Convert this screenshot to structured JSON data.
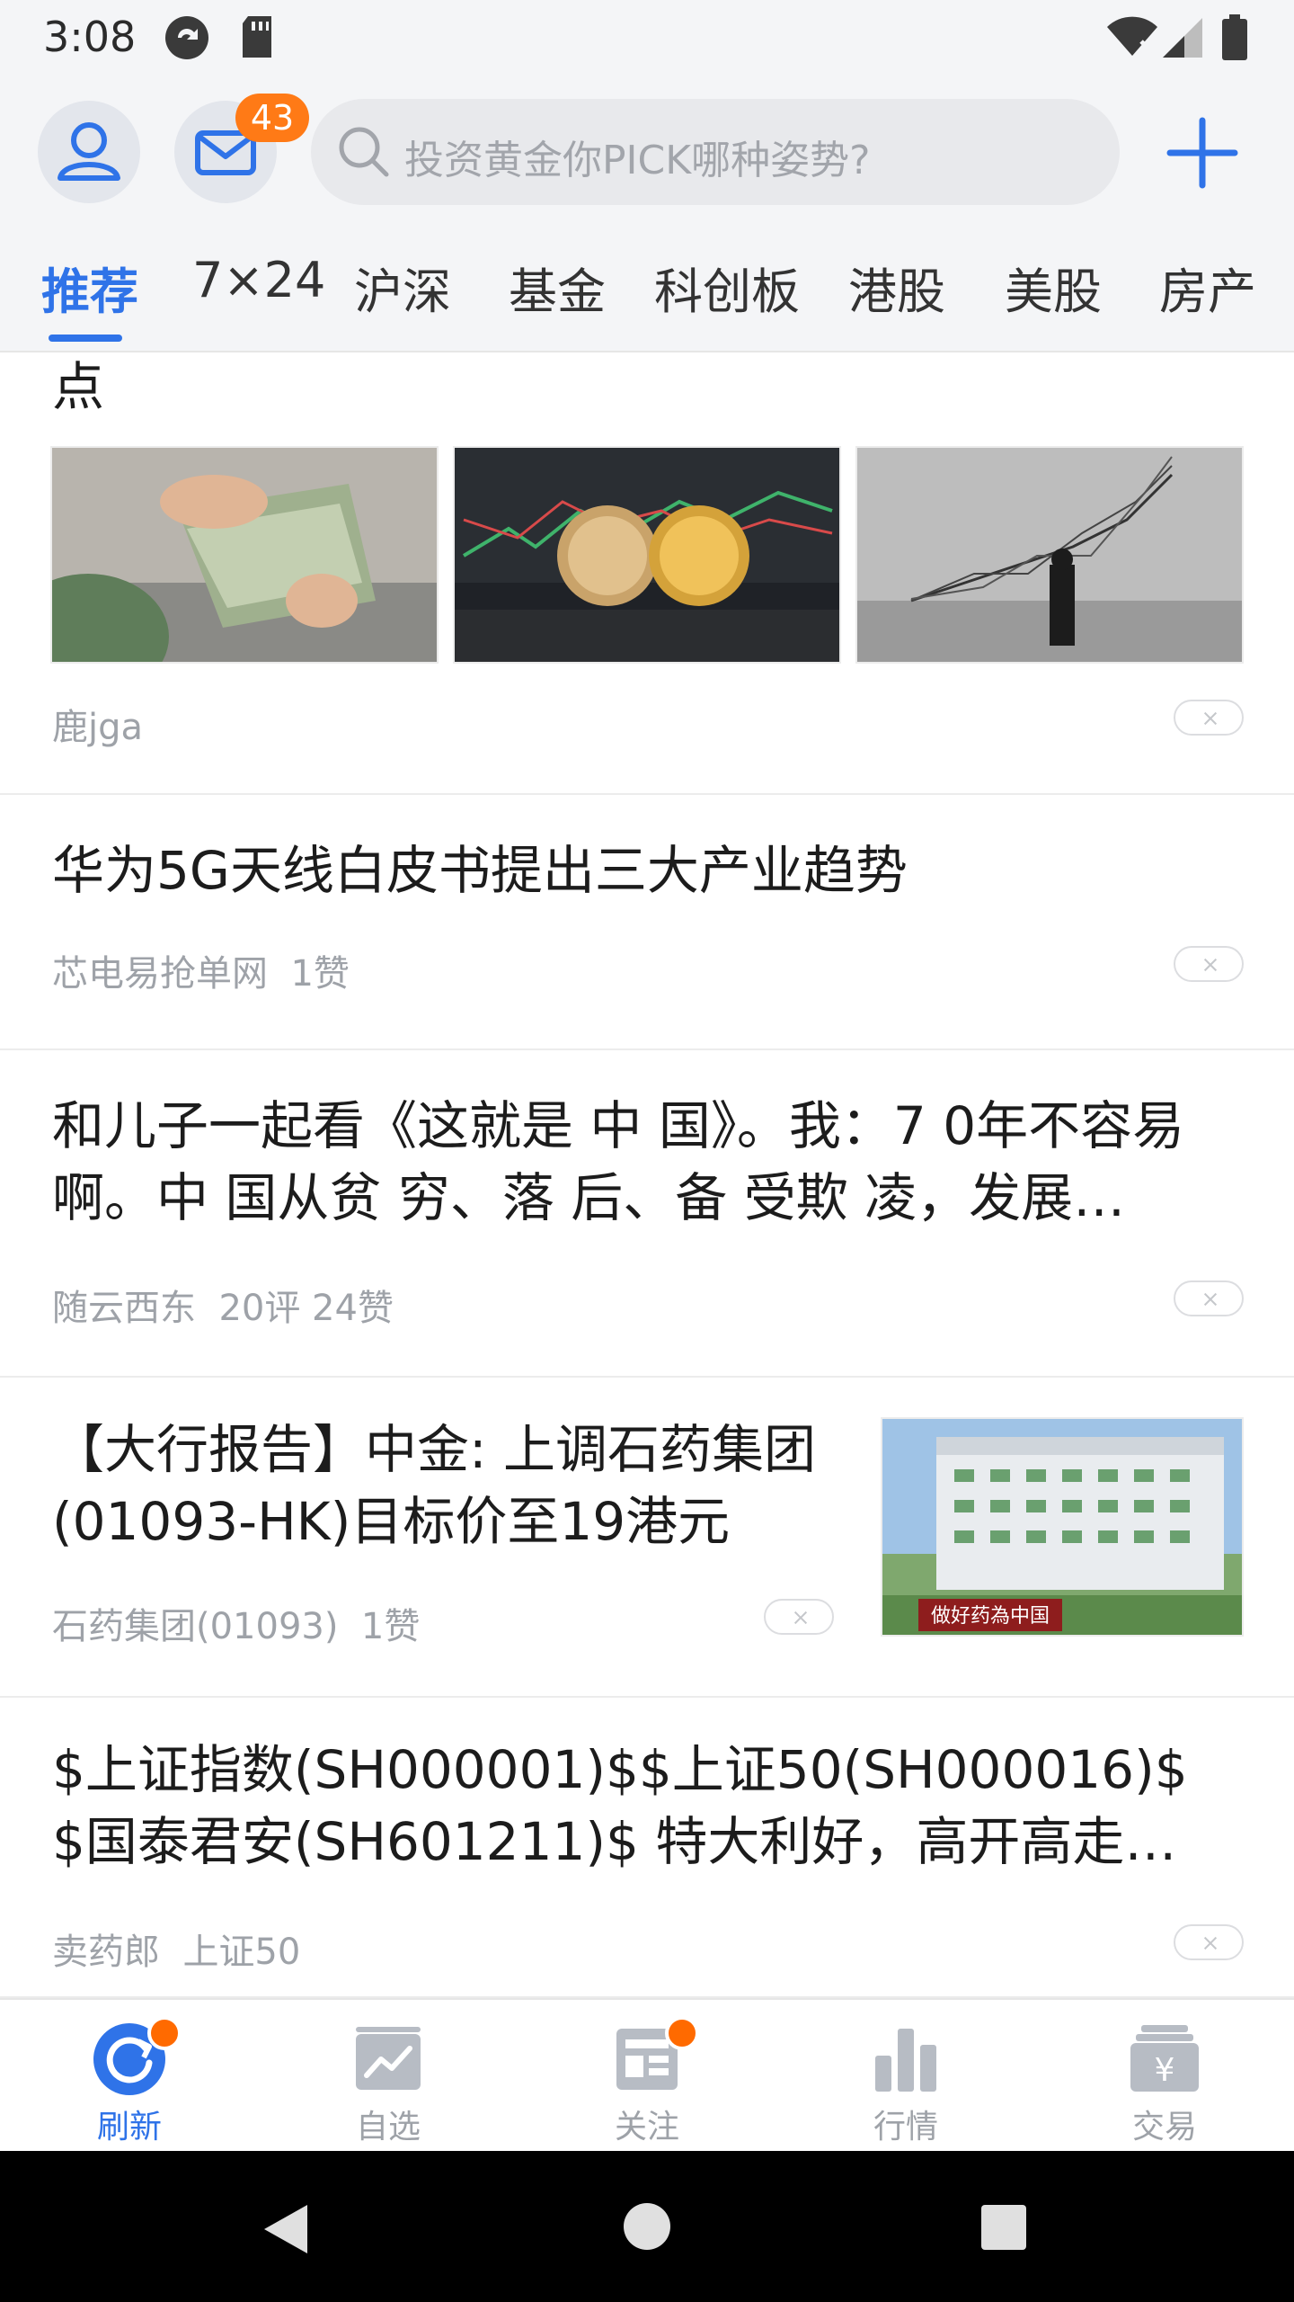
{
  "status_bar": {
    "time": "3:08"
  },
  "header": {
    "mail_badge": "43",
    "search_placeholder": "投资黄金你PICK哪种姿势?"
  },
  "tabs": [
    {
      "label": "推荐",
      "active": true
    },
    {
      "label": "7×24"
    },
    {
      "label": "沪深"
    },
    {
      "label": "基金"
    },
    {
      "label": "科创板"
    },
    {
      "label": "港股"
    },
    {
      "label": "美股"
    },
    {
      "label": "房产"
    }
  ],
  "feed": {
    "item0": {
      "title_tail": "点",
      "author": "鹿jga"
    },
    "item1": {
      "title": "华为5G天线白皮书提出三大产业趋势",
      "author": "芯电易抢单网",
      "stats": "1赞"
    },
    "item2": {
      "title": "和儿子一起看《这就是 中 国》。我：7 0年不容易啊。中 国从贫 穷、落 后、备 受欺 凌，发展…",
      "author": "随云西东",
      "stats": "20评  24赞"
    },
    "item3": {
      "title": "【大行报告】中金: 上调石药集团(01093-HK)目标价至19港元",
      "author": "石药集团(01093)",
      "stats": "1赞",
      "image_sign": "做好药為中国"
    },
    "item4": {
      "title": "$上证指数(SH000001)$$上证50(SH000016)$ $国泰君安(SH601211)$ 特大利好，高开高走…",
      "author": "卖药郎",
      "stats": "上证50"
    }
  },
  "bottom_nav": [
    {
      "label": "刷新",
      "active": true,
      "dot": true
    },
    {
      "label": "自选"
    },
    {
      "label": "关注",
      "dot": true
    },
    {
      "label": "行情"
    },
    {
      "label": "交易"
    }
  ],
  "colors": {
    "accent": "#2f73e8",
    "badge": "#ff7a16",
    "muted": "#9ea2a8"
  }
}
